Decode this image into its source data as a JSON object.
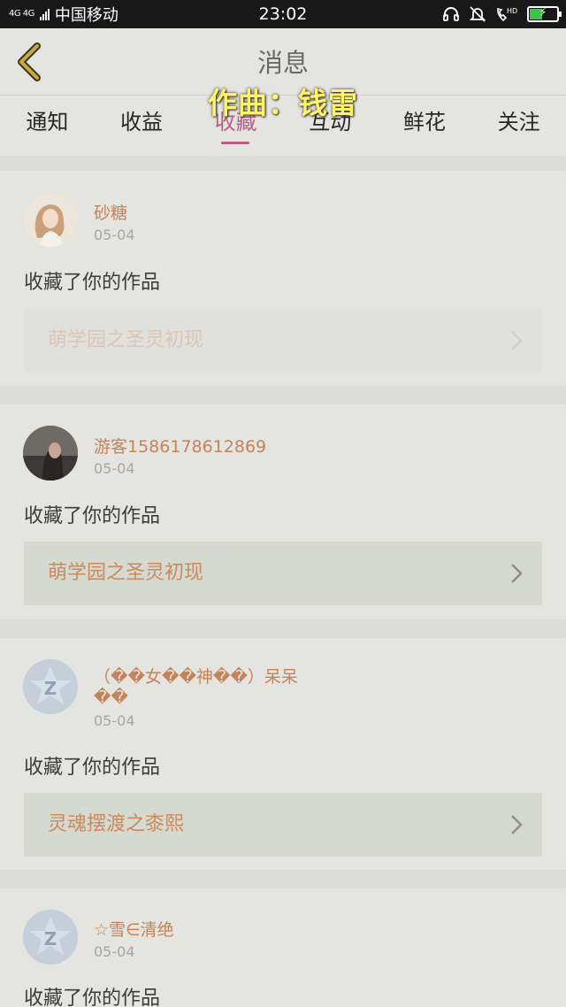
{
  "status_bar": {
    "network": "4G 4G",
    "carrier": "中国移动",
    "time": "23:02",
    "battery_level": 0.45,
    "icons": [
      "headset-icon",
      "silent-bell-icon",
      "hd-call-icon",
      "battery-charging-icon"
    ]
  },
  "nav": {
    "title": "消息"
  },
  "overlay_caption": "作曲：钱雷",
  "tabs": [
    {
      "label": "通知"
    },
    {
      "label": "收益"
    },
    {
      "label": "收藏"
    },
    {
      "label": "互动"
    },
    {
      "label": "鲜花"
    },
    {
      "label": "关注"
    }
  ],
  "active_tab": "收藏",
  "messages": [
    {
      "user": "砂糖",
      "date": "05-04",
      "action": "收藏了你的作品",
      "work": "萌学园之圣灵初现",
      "avatar": "photo-girl-light"
    },
    {
      "user": "游客1586178612869",
      "date": "05-04",
      "action": "收藏了你的作品",
      "work": "萌学园之圣灵初现",
      "avatar": "photo-girl-dark"
    },
    {
      "user_line1": "（��女��神��）呆呆",
      "user_line2": "��",
      "date": "05-04",
      "action": "收藏了你的作品",
      "work": "灵魂摆渡之桼熙",
      "avatar": "default-z-icon"
    },
    {
      "user": "☆雪∈清绝",
      "date": "05-04",
      "action": "收藏了你的作品",
      "avatar": "default-z-icon"
    }
  ],
  "colors": {
    "accent": "#b75e86",
    "username": "#c5835a",
    "background": "#dcdcd8",
    "caption": "#fff36a"
  }
}
